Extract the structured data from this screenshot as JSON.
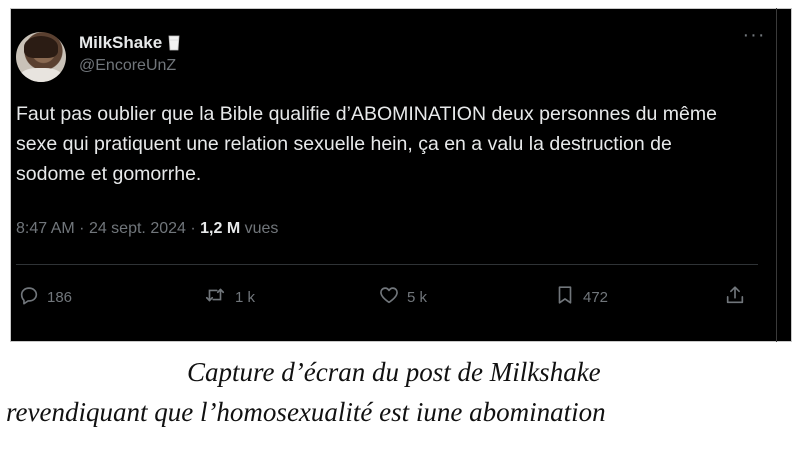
{
  "tweet": {
    "display_name": "MilkShake",
    "handle": "@EncoreUnZ",
    "more_label": "···",
    "text": "Faut pas oublier que la Bible qualifie d’ABOMINATION deux personnes du même sexe qui pratiquent une relation sexuelle hein, ça en a valu la destruction de sodome et gomorrhe.",
    "time": "8:47 AM",
    "separator": "·",
    "date": "24 sept. 2024",
    "views_count": "1,2 M",
    "views_label": "vues",
    "replies": "186",
    "reposts": "1 k",
    "likes": "5 k",
    "bookmarks": "472",
    "badge_icon": "milk-glass-icon"
  },
  "caption": {
    "line1": "Capture d’écran du post de Milkshake",
    "line2": "revendiquant que l’homosexualité est iune abomination"
  },
  "colors": {
    "background": "#000000",
    "text_primary": "#e7e9ea",
    "text_secondary": "#71767b",
    "divider": "#2f3336"
  }
}
